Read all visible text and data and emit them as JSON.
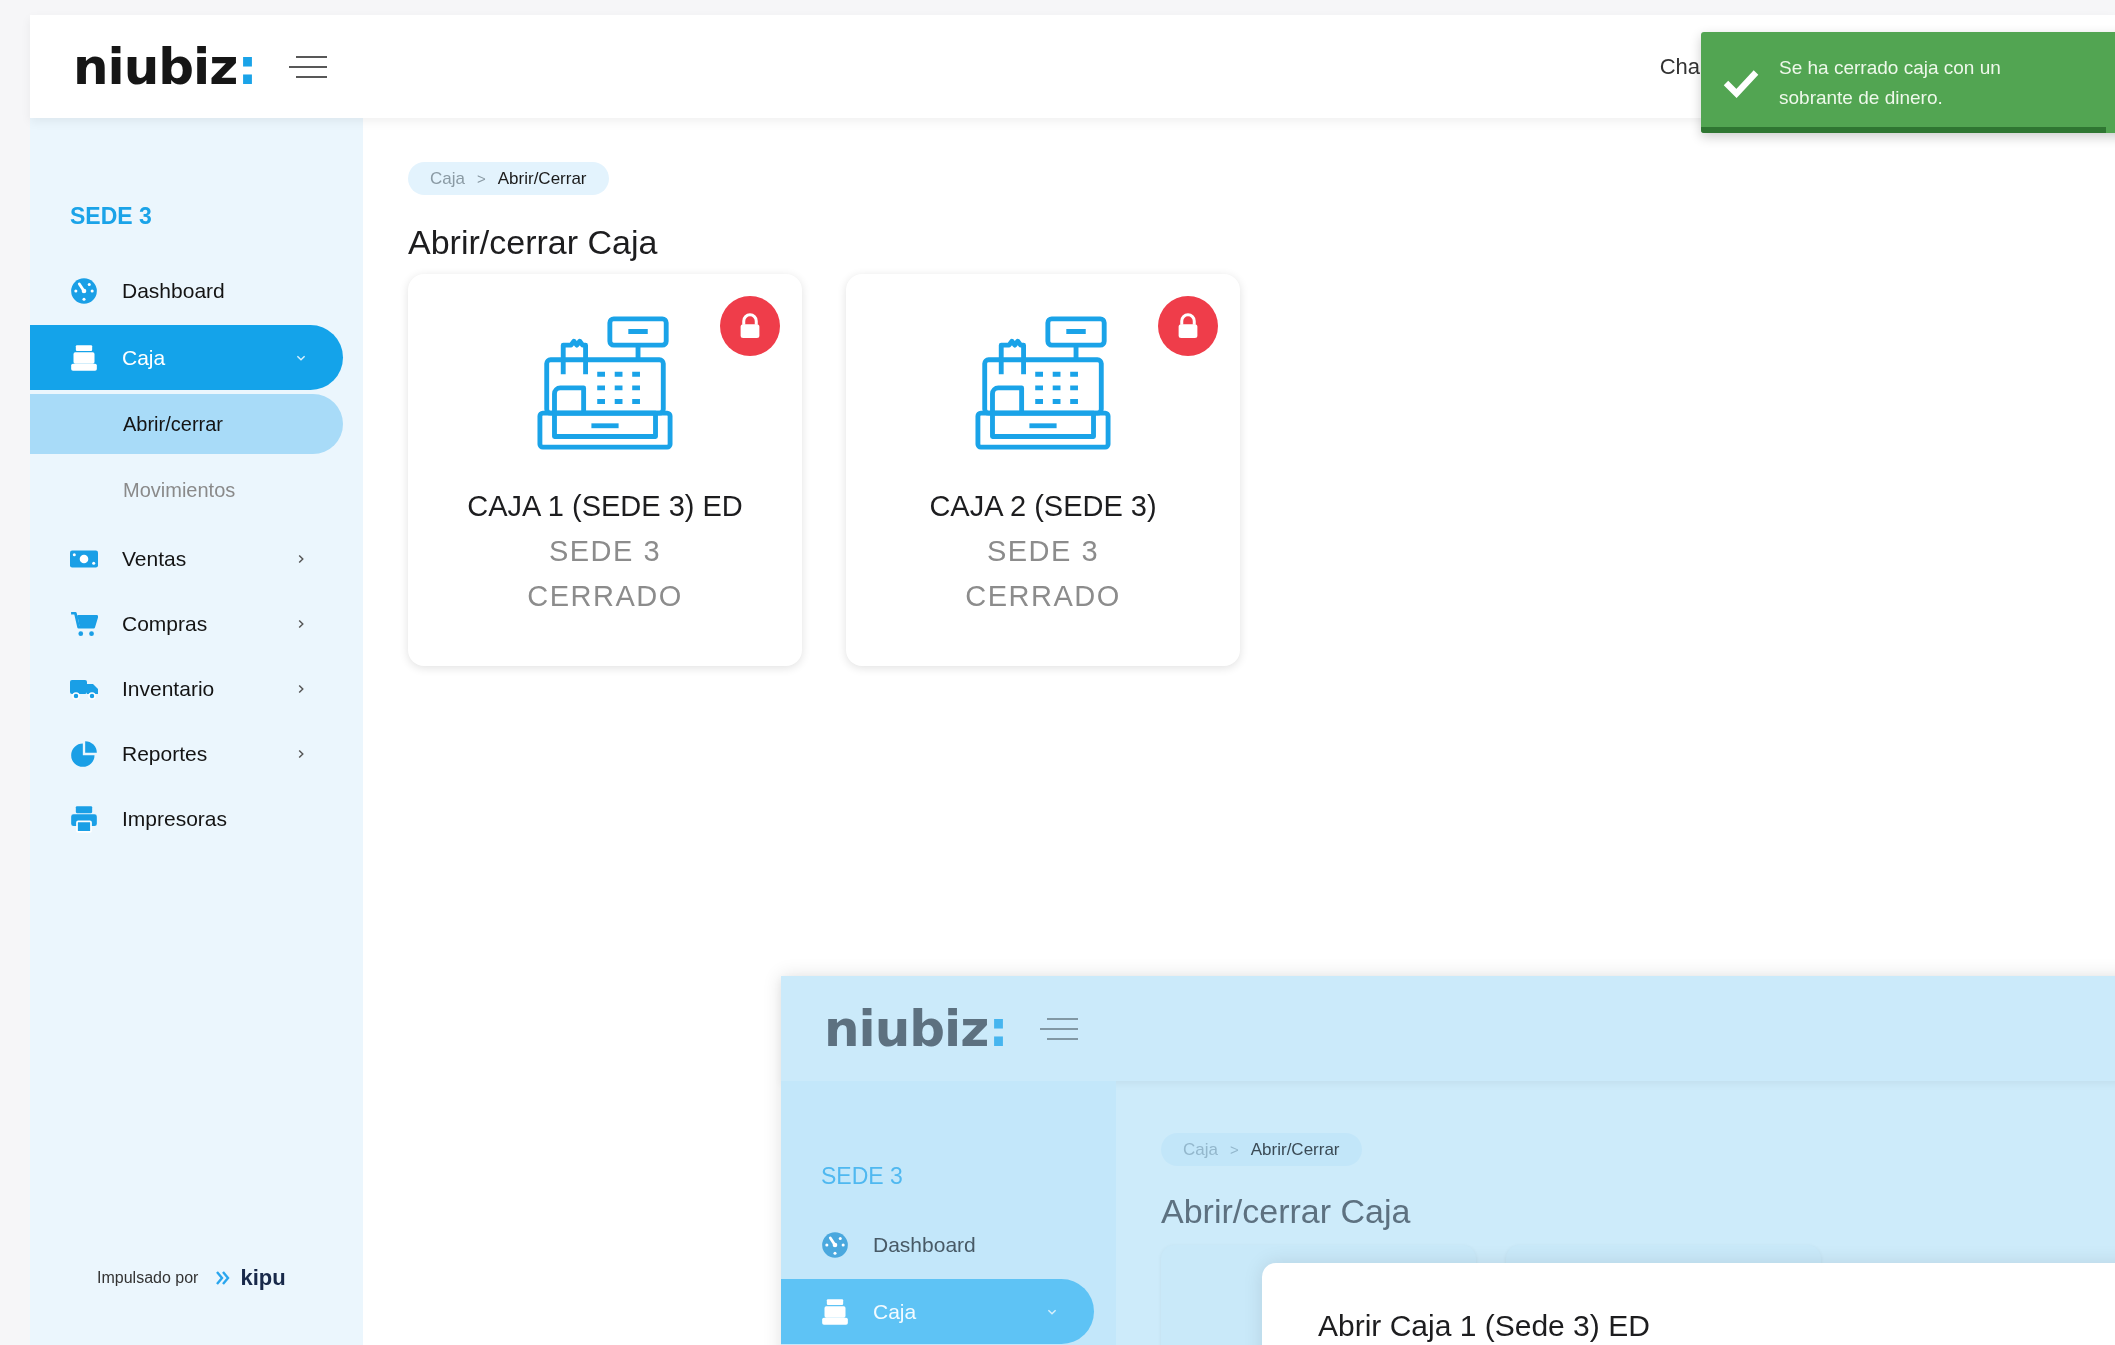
{
  "header": {
    "logo": "niubiz",
    "logo_mark": ":",
    "user": "Cha"
  },
  "toast": {
    "kind": "success",
    "message": "Se ha cerrado caja con un sobrante de dinero.",
    "level": 0.92
  },
  "sidebar": {
    "section": "SEDE 3",
    "items": [
      {
        "label": "Dashboard",
        "kind": "dashboard",
        "selected": false
      },
      {
        "label": "Caja",
        "kind": "register",
        "selected": true,
        "expanded": true,
        "children": [
          {
            "label": "Abrir/cerrar",
            "selected": true
          },
          {
            "label": "Movimientos",
            "selected": false
          }
        ]
      },
      {
        "label": "Ventas",
        "kind": "money",
        "selected": false,
        "expanded": false
      },
      {
        "label": "Compras",
        "kind": "cart",
        "selected": false,
        "expanded": false
      },
      {
        "label": "Inventario",
        "kind": "truck",
        "selected": false,
        "expanded": false
      },
      {
        "label": "Reportes",
        "kind": "pie",
        "selected": false,
        "expanded": false
      },
      {
        "label": "Impresoras",
        "kind": "printer",
        "selected": false
      }
    ],
    "footer": {
      "text": "Impulsado por",
      "brand": "kipu"
    }
  },
  "breadcrumb": {
    "items": [
      "Caja",
      "Abrir/Cerrar"
    ],
    "separator": ">"
  },
  "page_title": "Abrir/cerrar Caja",
  "cards": [
    {
      "name": "CAJA 1 (SEDE 3) ED",
      "sede": "SEDE 3",
      "status": "CERRADO",
      "locked": true
    },
    {
      "name": "CAJA 2 (SEDE 3)",
      "sede": "SEDE 3",
      "status": "CERRADO",
      "locked": true
    }
  ],
  "preview": {
    "logo": "niubiz",
    "logo_mark": ":",
    "breadcrumb": {
      "items": [
        "Caja",
        "Abrir/Cerrar"
      ],
      "separator": ">"
    },
    "page_title": "Abrir/cerrar Caja",
    "section": "SEDE 3",
    "items": [
      {
        "label": "Dashboard",
        "kind": "dashboard",
        "selected": false
      },
      {
        "label": "Caja",
        "kind": "register",
        "selected": true,
        "expanded": true
      }
    ],
    "modal": {
      "title": "Abrir Caja 1 (Sede 3) ED"
    }
  }
}
